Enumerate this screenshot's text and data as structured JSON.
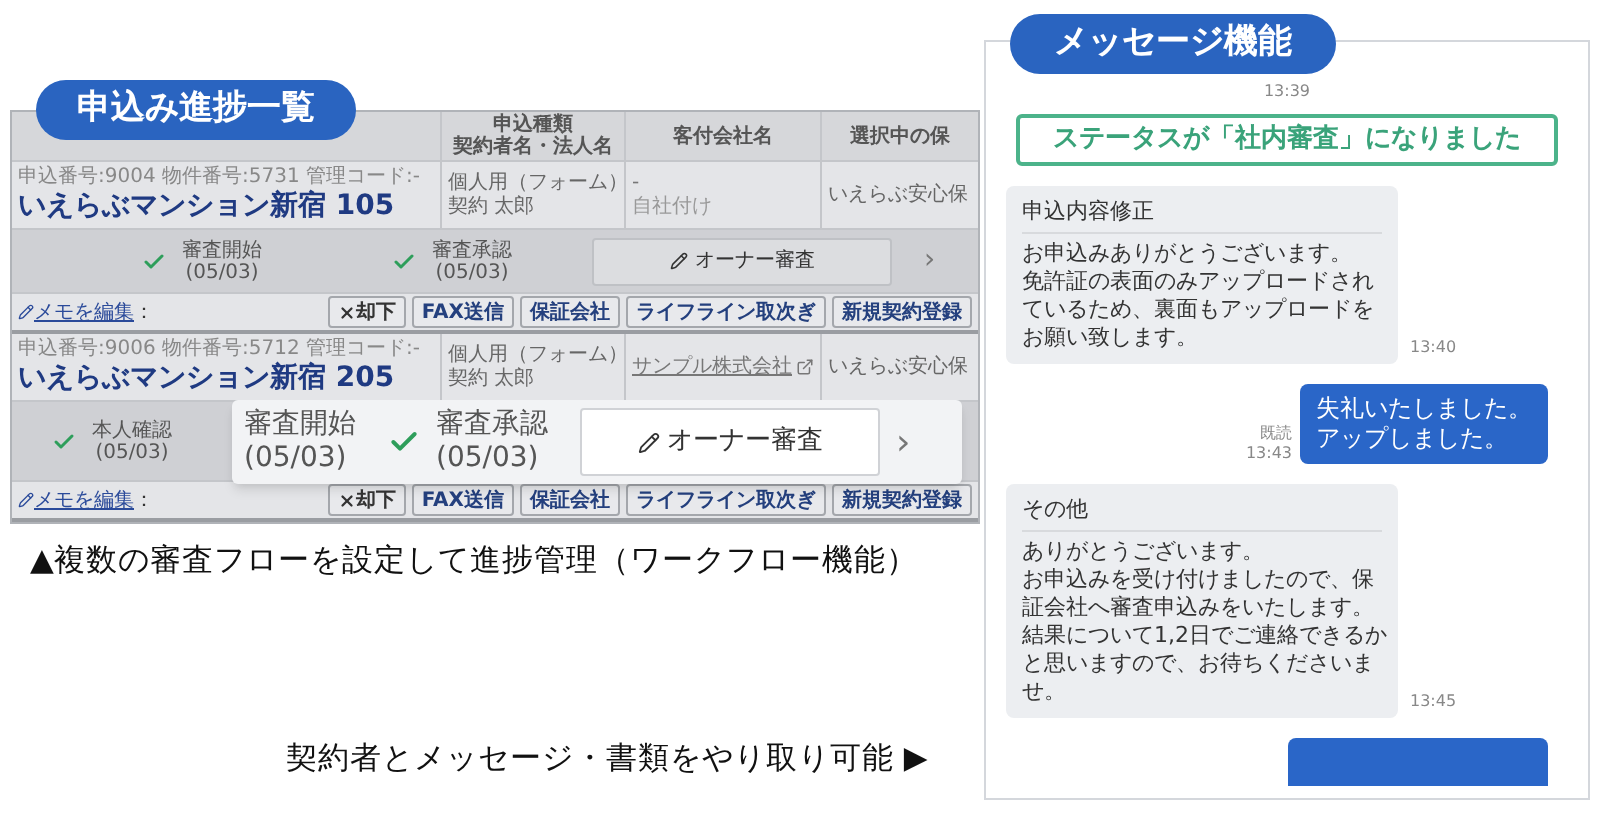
{
  "progress_panel": {
    "badge": "申込み進捗一覧",
    "columns": [
      {
        "lines": [
          "申込種類",
          "契約者名・法人名"
        ]
      },
      {
        "label": "客付会社名"
      },
      {
        "label": "選択中の保"
      }
    ],
    "rows": [
      {
        "meta": "申込番号:9004 物件番号:5731 管理コード:-",
        "name": "いえらぶマンション新宿 105",
        "type": "個人用（フォーム）",
        "contractor": "契約 太郎",
        "agent": {
          "link": false,
          "text": "-",
          "sub": "自社付け"
        },
        "guarantor": "いえらぶ安心保",
        "steps": [
          {
            "label": "審査開始",
            "date": "(05/03)",
            "checked": true
          },
          {
            "label": "審査承認",
            "date": "(05/03)",
            "checked": true
          }
        ],
        "next_step": "オーナー審査",
        "next_arrow": "›",
        "memo": "メモを編集",
        "memo_suffix": "：",
        "actions": [
          {
            "label": "却下",
            "kind": "reject"
          },
          {
            "label": "FAX送信",
            "kind": "plain"
          },
          {
            "label": "保証会社",
            "kind": "plain"
          },
          {
            "label": "ライフライン取次ぎ",
            "kind": "plain"
          },
          {
            "label": "新規契約登録",
            "kind": "plain"
          }
        ]
      },
      {
        "meta": "申込番号:9006 物件番号:5712 管理コード:-",
        "name": "いえらぶマンション新宿 205",
        "type": "個人用（フォーム）",
        "contractor": "契約 太郎",
        "agent": {
          "link": true,
          "text": "サンプル株式会社"
        },
        "guarantor": "いえらぶ安心保",
        "steps": [
          {
            "label": "本人確認",
            "date": "(05/03)",
            "checked": true
          }
        ],
        "zoom": {
          "steps": [
            {
              "label": "審査開始",
              "date": "(05/03)",
              "checked": false
            },
            {
              "label": "審査承認",
              "date": "(05/03)",
              "checked": true
            }
          ],
          "next_step": "オーナー審査",
          "next_arrow": "›"
        },
        "memo": "メモを編集",
        "memo_suffix": "：",
        "actions": [
          {
            "label": "却下",
            "kind": "reject"
          },
          {
            "label": "FAX送信",
            "kind": "plain"
          },
          {
            "label": "保証会社",
            "kind": "plain"
          },
          {
            "label": "ライフライン取次ぎ",
            "kind": "plain"
          },
          {
            "label": "新規契約登録",
            "kind": "plain"
          }
        ]
      }
    ],
    "caption": "▲複数の審査フローを設定して進捗管理（ワークフロー機能）"
  },
  "caption_bottom": "契約者とメッセージ・書類をやり取り可能 ▶",
  "message_panel": {
    "badge": "メッセージ機能",
    "messages": [
      {
        "kind": "time",
        "text": "13:39"
      },
      {
        "kind": "status",
        "text": "ステータスが「社内審査」になりました"
      },
      {
        "kind": "received",
        "title": "申込内容修正",
        "lines": [
          "お申込みありがとうございます。",
          "免許証の表面のみアップロードされ",
          "ているため、裏面もアップロードを",
          "お願い致します。"
        ],
        "time": "13:40"
      },
      {
        "kind": "sent",
        "lines": [
          "失礼いたしました。",
          "アップしました。"
        ],
        "read": "既読",
        "time": "13:43"
      },
      {
        "kind": "received",
        "title": "その他",
        "lines": [
          "ありがとうございます。",
          "お申込みを受け付けましたので、保",
          "証会社へ審査申込みをいたします。",
          "結果について1,2日でご連絡できるか",
          "と思いますので、お待ちくださいま",
          "せ。"
        ],
        "time": "13:45"
      },
      {
        "kind": "sent"
      }
    ]
  }
}
